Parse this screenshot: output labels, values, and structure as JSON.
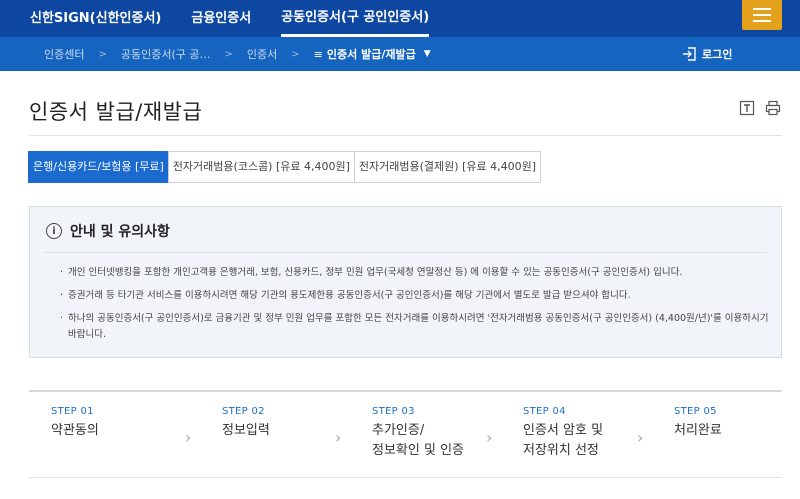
{
  "topnav": {
    "items": [
      {
        "label": "신한SIGN(신한인증서)",
        "active": false
      },
      {
        "label": "금융인증서",
        "active": false
      },
      {
        "label": "공동인증서(구 공인인증서)",
        "active": true
      }
    ]
  },
  "breadcrumb": {
    "items": [
      "인증센터",
      "공동인증서(구 공…",
      "인증서"
    ],
    "current": "인증서 발급/재발급",
    "login_label": "로그인"
  },
  "page": {
    "title": "인증서 발급/재발급"
  },
  "tabs": [
    {
      "label": "은행/신용카드/보험용 [무료]",
      "active": true
    },
    {
      "label": "전자거래범용(코스콤) [유료 4,400원]",
      "active": false
    },
    {
      "label": "전자거래범용(결제원) [유료 4,400원]",
      "active": false
    }
  ],
  "notice": {
    "title": "안내 및 유의사항",
    "items": [
      "개인 인터넷뱅킹을 포함한 개인고객용 은행거래, 보험, 신용카드, 정부 민원 업무(국세청 연말정산 등) 에 이용할 수 있는 공동인증서(구 공인인증서) 입니다.",
      "증권거래 등 타기관 서비스를 이용하시려면 해당 기관의 용도제한용 공동인증서(구 공인인증서)를 해당 기관에서 별도로 발급 받으셔야 합니다.",
      "하나의 공동인증서(구 공인인증서)로 금융기관 및 정부 민원 업무를 포함한 모든 전자거래를 이용하시려면 '전자거래범용 공동인증서(구 공인인증서) (4,400원/년)'를 이용하시기 바랍니다."
    ]
  },
  "steps": [
    {
      "num": "STEP 01",
      "label": "약관동의"
    },
    {
      "num": "STEP 02",
      "label": "정보입력"
    },
    {
      "num": "STEP 03",
      "label": "추가인증/\n정보확인 및 인증"
    },
    {
      "num": "STEP 04",
      "label": "인증서 암호 및\n저장위치 선정"
    },
    {
      "num": "STEP 05",
      "label": "처리완료"
    }
  ],
  "icons": {
    "menu": "hamburger-menu-icon",
    "login": "login-icon",
    "text-size": "text-size-icon",
    "print": "print-icon",
    "info": "info-icon",
    "chevron": "chevron-right-icon"
  },
  "colors": {
    "topbar": "#0d47a1",
    "crumbbar": "#1565c0",
    "accent": "#1b6ad0",
    "menu_button": "#e3a11c"
  }
}
